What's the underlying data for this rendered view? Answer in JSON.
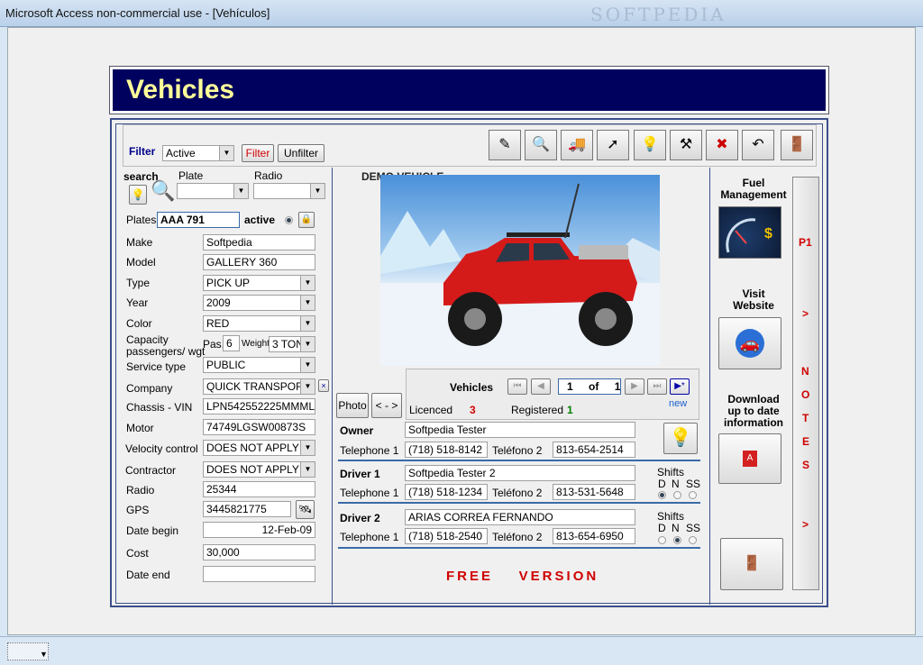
{
  "window": {
    "title": "Microsoft Access non-commercial use - [Vehículos]",
    "watermark": "SOFTPEDIA"
  },
  "header": {
    "title": "Vehicles"
  },
  "filter": {
    "label": "Filter",
    "value": "Active",
    "filter_btn": "Filter",
    "unfilter_btn": "Unfilter"
  },
  "search": {
    "label": "search",
    "plate_label": "Plate",
    "radio_label": "Radio"
  },
  "vehicle": {
    "plates_label": "Plates",
    "plates": "AAA 791",
    "active_label": "active",
    "make_label": "Make",
    "make": "Softpedia",
    "model_label": "Model",
    "model": "GALLERY 360",
    "type_label": "Type",
    "type": "PICK UP",
    "year_label": "Year",
    "year": "2009",
    "color_label": "Color",
    "color": "RED",
    "capacity_label": "Capacity\npassengers/ wgt",
    "pas_label": "Pas.",
    "pas": "6",
    "weight_label": "Weight",
    "weight": "3 TON",
    "service_label": "Service type",
    "service": "PUBLIC",
    "company_label": "Company",
    "company": "QUICK TRANSPORT",
    "chassis_label": "Chassis - VIN",
    "chassis": "LPN542552225MMML",
    "motor_label": "Motor",
    "motor": "74749LGSW00873S",
    "velocity_label": "Velocity control",
    "velocity": "DOES NOT APPLY",
    "contractor_label": "Contractor",
    "contractor": "DOES NOT APPLY",
    "radio_label": "Radio",
    "radio": "25344",
    "gps_label": "GPS",
    "gps": "3445821775",
    "date_begin_label": "Date begin",
    "date_begin": "12-Feb-09",
    "cost_label": "Cost",
    "cost": "30,000",
    "date_end_label": "Date end",
    "date_end": ""
  },
  "photo": {
    "caption": "DEMO VEHICLE",
    "photo_btn": "Photo",
    "swap_btn": "< - >"
  },
  "nav": {
    "label": "Vehicles",
    "current": "1",
    "of": "of",
    "total": "1",
    "new_label": "new",
    "licenced_label": "Licenced",
    "licenced": "3",
    "registered_label": "Registered",
    "registered": "1"
  },
  "owner": {
    "label": "Owner",
    "name": "Softpedia Tester",
    "tel1_label": "Telephone 1",
    "tel1": "(718) 518-8142",
    "tel2_label": "Teléfono 2",
    "tel2": "813-654-2514"
  },
  "driver1": {
    "label": "Driver 1",
    "name": "Softpedia Tester 2",
    "tel1_label": "Telephone 1",
    "tel1": "(718) 518-1234",
    "tel2_label": "Teléfono 2",
    "tel2": "813-531-5648"
  },
  "driver2": {
    "label": "Driver 2",
    "name": "ARIAS CORREA FERNANDO",
    "tel1_label": "Telephone 1",
    "tel1": "(718) 518-2540",
    "tel2_label": "Teléfono 2",
    "tel2": "813-654-6950"
  },
  "shifts": {
    "label": "Shifts",
    "d": "D",
    "n": "N",
    "ss": "SS"
  },
  "free": "FREE    VERSION",
  "right": {
    "fuel": "Fuel\nManagement",
    "visit": "Visit\nWebsite",
    "download": "Download\nup to date\ninformation"
  },
  "tabs": {
    "p1": "P1",
    "arrow": ">",
    "notes": [
      "N",
      "O",
      "T",
      "E",
      "S"
    ]
  },
  "colors": {
    "header_bg": "#00005e",
    "header_text": "#ffff99",
    "accent_red": "#d00000"
  }
}
